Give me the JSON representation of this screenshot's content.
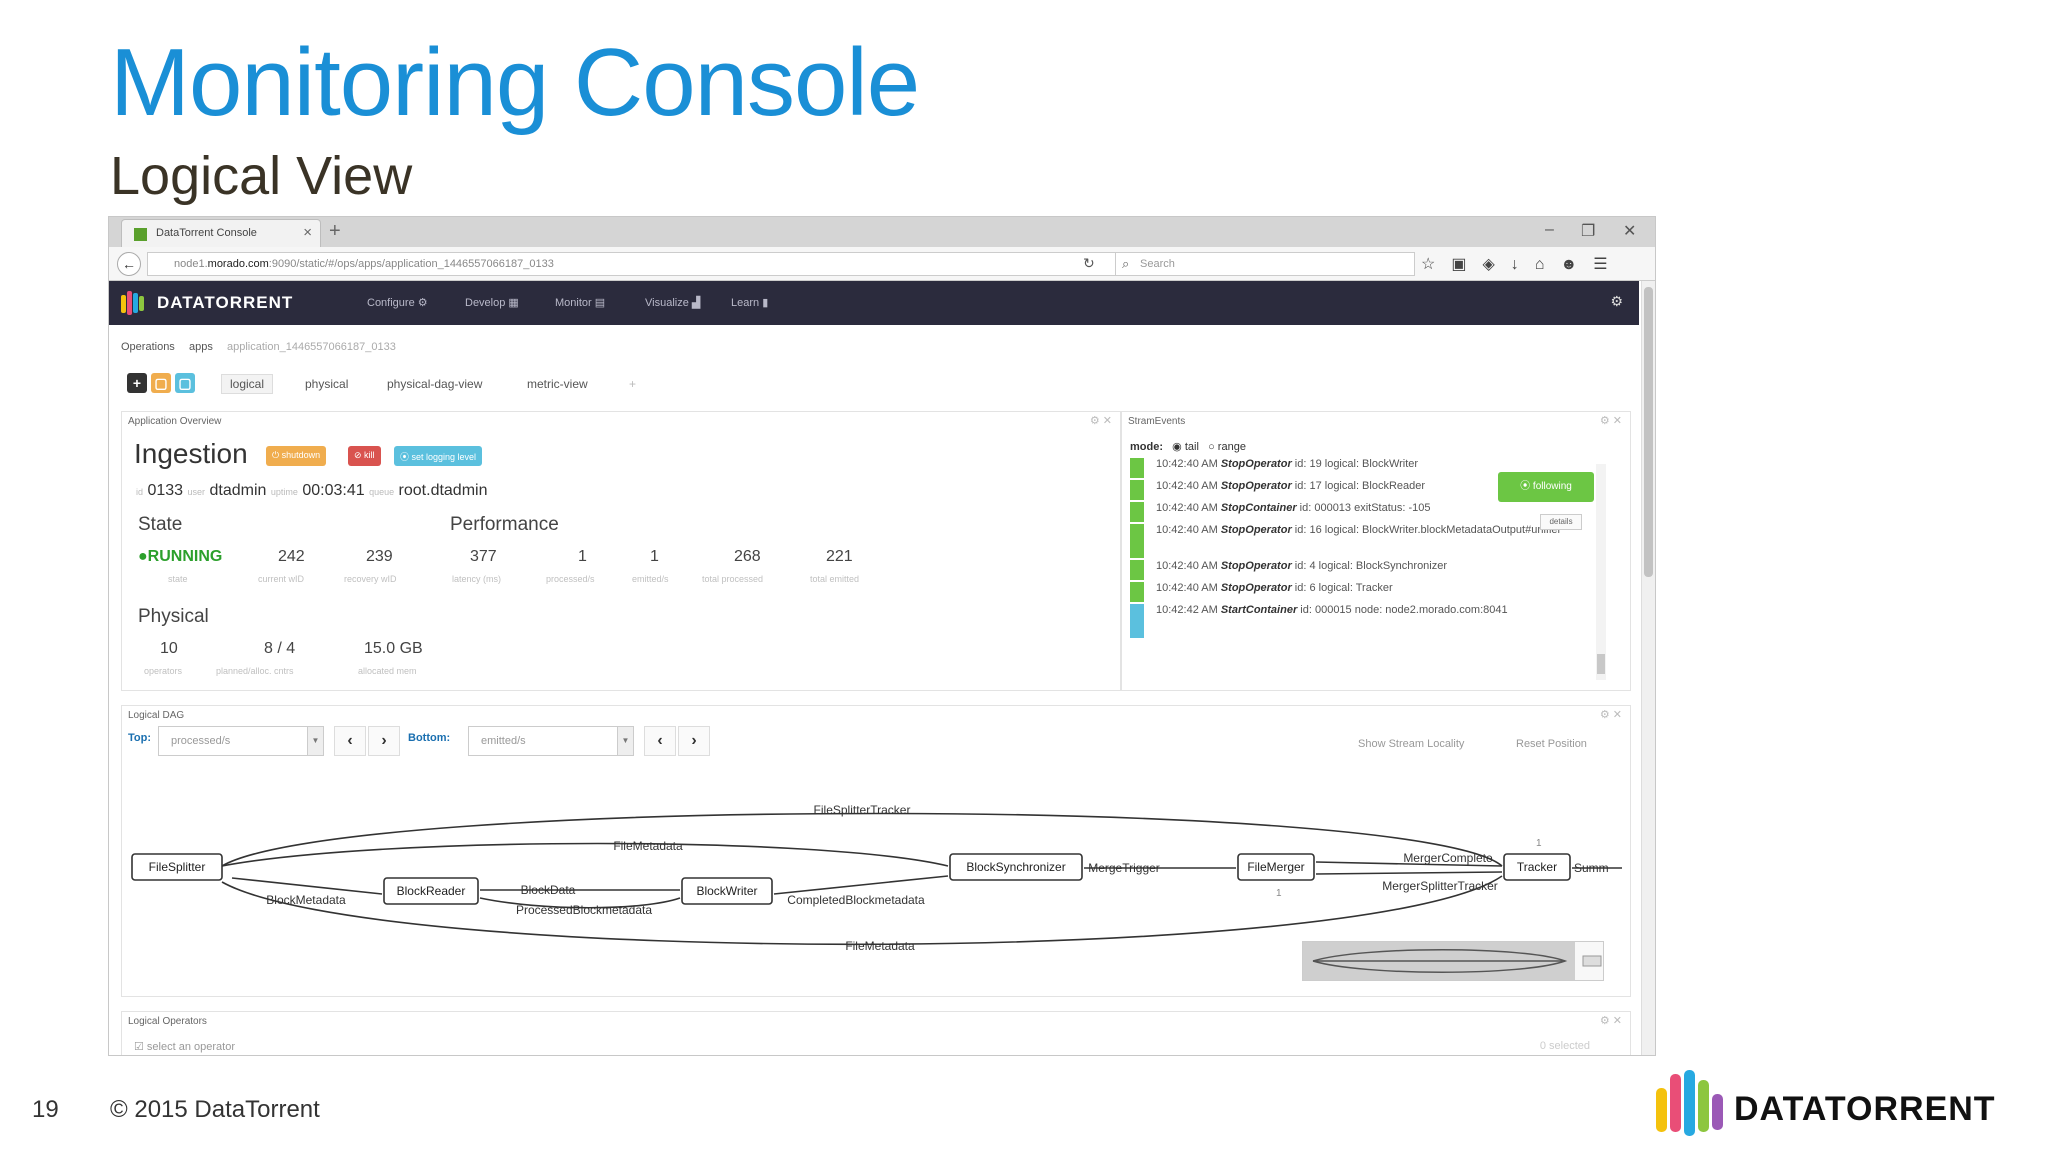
{
  "slide": {
    "title": "Monitoring Console",
    "subtitle": "Logical View",
    "page_number": "19",
    "copyright": "© 2015 DataTorrent",
    "logo_text": "DATATORRENT"
  },
  "browser": {
    "tab_title": "DataTorrent Console",
    "url_prefix": "node1.",
    "url_host": "morado.com",
    "url_path": ":9090/static/#/ops/apps/application_1446557066187_0133",
    "search_placeholder": "Search"
  },
  "app": {
    "brand": "DATATORRENT",
    "menu": [
      "Configure ⚙",
      "Develop ▦",
      "Monitor ▤",
      "Visualize ▟",
      "Learn ▮"
    ],
    "breadcrumb": [
      "Operations",
      "apps",
      "application_1446557066187_0133"
    ],
    "view_tabs": [
      "logical",
      "physical",
      "physical-dag-view",
      "metric-view",
      "+"
    ]
  },
  "overview": {
    "panel_title": "Application Overview",
    "app_name": "Ingestion",
    "badges": [
      "⏻ shutdown",
      "⊘ kill",
      "⦿ set logging level"
    ],
    "id_label": "id",
    "id_value": "0133",
    "user_label": "user",
    "user_value": "dtadmin",
    "uptime_label": "uptime",
    "uptime_value": "00:03:41",
    "queue_label": "queue",
    "queue_value": "root.dtadmin",
    "state_title": "State",
    "performance_title": "Performance",
    "physical_title": "Physical",
    "state_stats": [
      {
        "value": "●RUNNING",
        "label": "state"
      },
      {
        "value": "242",
        "label": "current wID"
      },
      {
        "value": "239",
        "label": "recovery wID"
      }
    ],
    "performance_stats": [
      {
        "value": "377",
        "label": "latency (ms)"
      },
      {
        "value": "1",
        "label": "processed/s"
      },
      {
        "value": "1",
        "label": "emitted/s"
      },
      {
        "value": "268",
        "label": "total processed"
      },
      {
        "value": "221",
        "label": "total emitted"
      }
    ],
    "physical_stats": [
      {
        "value": "10",
        "label": "operators"
      },
      {
        "value": "8 / 4",
        "label": "planned/alloc. cntrs"
      },
      {
        "value": "15.0 GB",
        "label": "allocated mem"
      }
    ]
  },
  "events": {
    "panel_title": "StramEvents",
    "mode_label": "mode:",
    "mode_tail": "tail",
    "mode_range": "range",
    "following_label": "⦿ following",
    "details_label": "details",
    "items": [
      {
        "time": "10:42:40 AM",
        "name": "StopOperator",
        "rest": " id: 19 logical: BlockWriter",
        "color": "#6cc644"
      },
      {
        "time": "10:42:40 AM",
        "name": "StopOperator",
        "rest": " id: 17 logical: BlockReader",
        "color": "#6cc644"
      },
      {
        "time": "10:42:40 AM",
        "name": "StopContainer",
        "rest": " id: 000013 exitStatus: -105",
        "color": "#6cc644"
      },
      {
        "time": "10:42:40 AM",
        "name": "StopOperator",
        "rest": " id: 16 logical: BlockWriter.blockMetadataOutput#unifier",
        "color": "#6cc644"
      },
      {
        "time": "10:42:40 AM",
        "name": "StopOperator",
        "rest": " id: 4 logical: BlockSynchronizer",
        "color": "#6cc644"
      },
      {
        "time": "10:42:40 AM",
        "name": "StopOperator",
        "rest": " id: 6 logical: Tracker",
        "color": "#6cc644"
      },
      {
        "time": "10:42:42 AM",
        "name": "StartContainer",
        "rest": " id: 000015 node: node2.morado.com:8041",
        "color": "#5bc0de"
      }
    ]
  },
  "dag": {
    "panel_title": "Logical DAG",
    "top_label": "Top:",
    "top_value": "processed/s",
    "bottom_label": "Bottom:",
    "bottom_value": "emitted/s",
    "show_locality": "Show Stream Locality",
    "reset_position": "Reset Position",
    "nodes": [
      "FileSplitter",
      "BlockReader",
      "BlockWriter",
      "BlockSynchronizer",
      "FileMerger",
      "Tracker"
    ],
    "edges": [
      "FileSplitterTracker",
      "FileMetadata",
      "BlockMetadata",
      "BlockData",
      "ProcessedBlockmetadata",
      "CompletedBlockmetadata",
      "MergeTrigger",
      "MergerComplete",
      "MergerSplitterTracker",
      "FileMetadata",
      "Summ"
    ],
    "numbers": [
      "1",
      "1"
    ]
  },
  "operators": {
    "panel_title": "Logical Operators",
    "search_placeholder": "select an operator",
    "selected_label": "0 selected"
  },
  "colors": {
    "title_blue": "#1a8fd6",
    "appbar": "#2b2b3d",
    "running_green": "#2ca02c",
    "following_green": "#6cc644"
  }
}
